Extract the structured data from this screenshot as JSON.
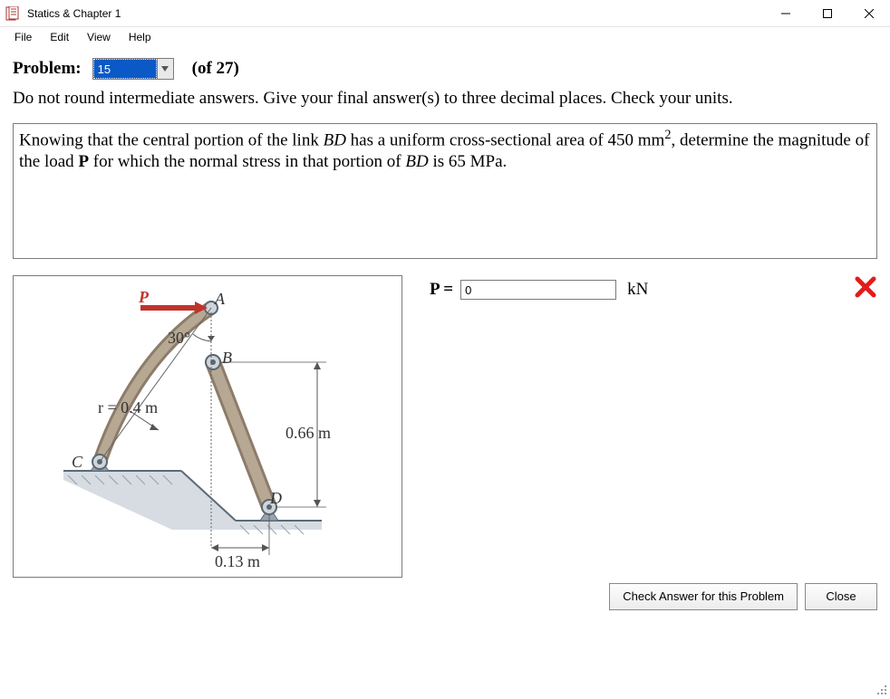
{
  "window": {
    "title": "Statics & Chapter 1"
  },
  "menubar": [
    "File",
    "Edit",
    "View",
    "Help"
  ],
  "problem_selector": {
    "label": "Problem:",
    "value": "15",
    "of_label": "(of 27)"
  },
  "instructions": "Do not round intermediate answers.  Give your final answer(s) to three decimal places.  Check your units.",
  "problem_text": {
    "before_sup": "Knowing that the central portion of the link ",
    "italic1": "BD",
    "mid1": " has a uniform cross-sectional area of 450 mm",
    "sup": "2",
    "mid2": ", determine the magnitude of the load ",
    "boldP": "P",
    "mid3": " for which the normal stress in that portion of ",
    "italic2": "BD",
    "tail": " is 65 MPa."
  },
  "figure": {
    "P": "P",
    "A": "A",
    "B": "B",
    "C": "C",
    "D": "D",
    "angle": "30°",
    "r": "r = 0.4 m",
    "h": "0.66 m",
    "w": "0.13 m"
  },
  "answer": {
    "label": "P =",
    "value": "0",
    "unit": "kN"
  },
  "buttons": {
    "check": "Check Answer for this Problem",
    "close": "Close"
  }
}
